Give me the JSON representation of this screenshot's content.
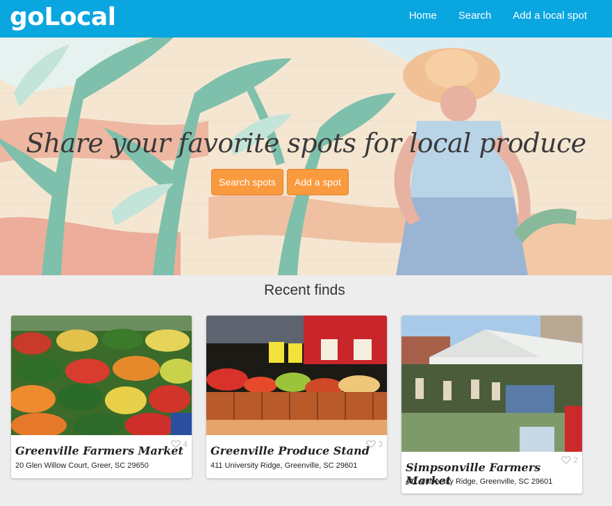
{
  "brand": "goLocal",
  "nav": {
    "home": "Home",
    "search": "Search",
    "add": "Add a local spot"
  },
  "hero": {
    "title": "Share your favorite spots for local produce",
    "search_button": "Search spots",
    "add_button": "Add a spot"
  },
  "recent": {
    "title": "Recent finds",
    "cards": [
      {
        "name": "Greenville Farmers Market",
        "address": "20 Glen Willow Court, Greer, SC 29650",
        "likes": "4"
      },
      {
        "name": "Greenville Produce Stand",
        "address": "411 University Ridge, Greenville, SC 29601",
        "likes": "3"
      },
      {
        "name": "Simpsonville Farmers Market",
        "address": "411 University Ridge, Greenville, SC 29601",
        "likes": "2"
      }
    ]
  },
  "colors": {
    "navbar": "#0aa6e0",
    "accent_button": "#fa9a3e",
    "page_background": "#ededed"
  },
  "icons": [
    "heart-icon"
  ]
}
